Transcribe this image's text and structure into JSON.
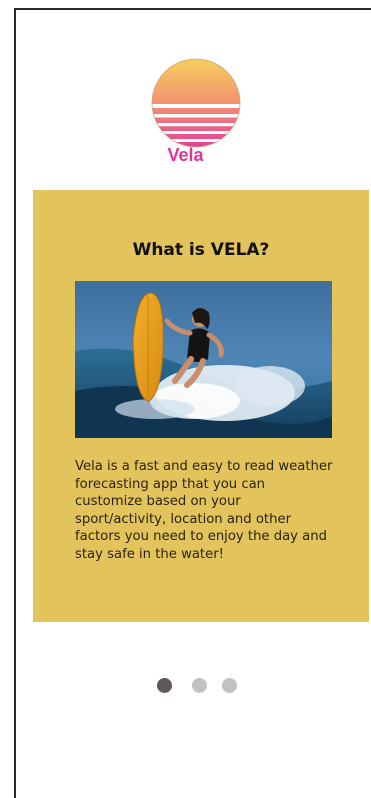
{
  "app": {
    "brand_name": "Vela"
  },
  "onboarding": {
    "title": "What is VELA?",
    "photo_subject": "surfer-with-yellow-board",
    "description": "Vela is a fast and easy to read weather forecasting app that you can customize based on your sport/activity, location and other factors you need to enjoy the day and stay safe in the water!",
    "card_color": "#e3c35b"
  },
  "pagination": {
    "total": 3,
    "current": 1,
    "active_color": "#5e575c",
    "inactive_color": "#c4c1c4"
  },
  "colors": {
    "brand": "#e0369b",
    "sun_top": "#f7c35c",
    "sun_bottom": "#e04aa0"
  }
}
